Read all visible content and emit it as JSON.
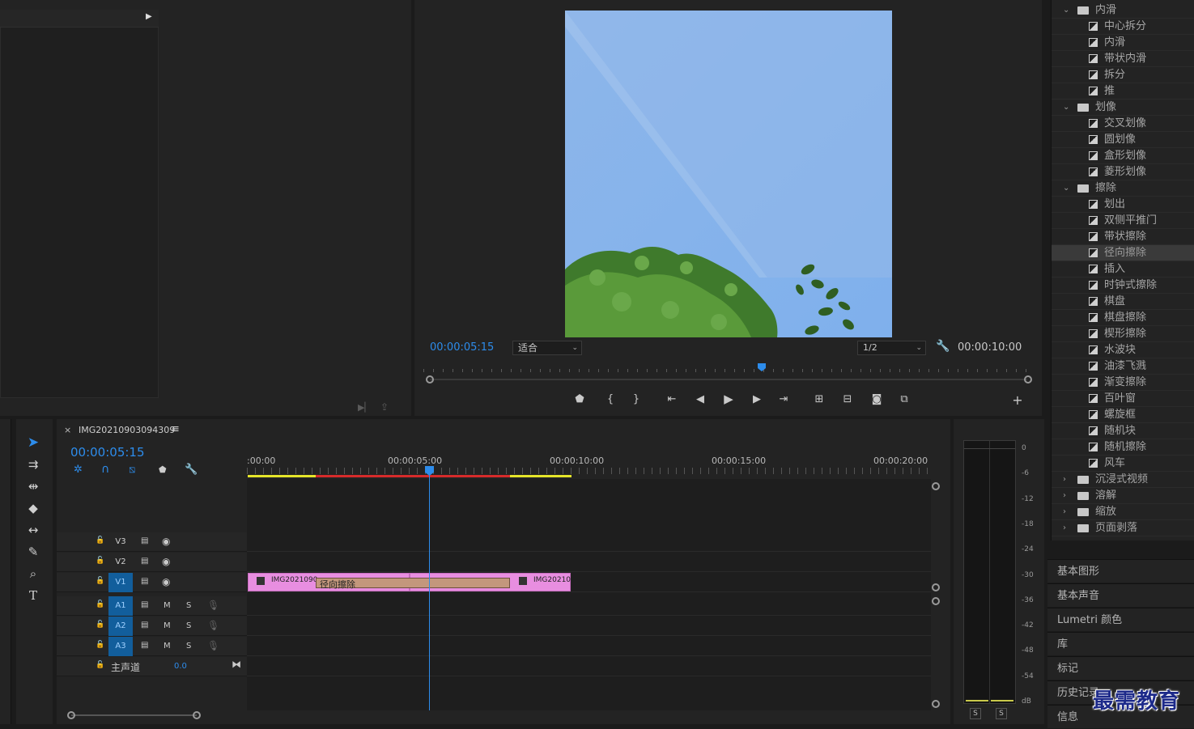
{
  "program": {
    "current_time": "00:00:05:15",
    "fit_label": "适合",
    "resolution": "1/2",
    "duration": "00:00:10:00"
  },
  "effects": {
    "items": [
      {
        "type": "folder",
        "label": "内滑",
        "expanded": true
      },
      {
        "type": "effect",
        "label": "中心拆分"
      },
      {
        "type": "effect",
        "label": "内滑"
      },
      {
        "type": "effect",
        "label": "带状内滑"
      },
      {
        "type": "effect",
        "label": "拆分"
      },
      {
        "type": "effect",
        "label": "推"
      },
      {
        "type": "folder",
        "label": "划像",
        "expanded": true
      },
      {
        "type": "effect",
        "label": "交叉划像"
      },
      {
        "type": "effect",
        "label": "圆划像"
      },
      {
        "type": "effect",
        "label": "盒形划像"
      },
      {
        "type": "effect",
        "label": "菱形划像"
      },
      {
        "type": "folder",
        "label": "擦除",
        "expanded": true
      },
      {
        "type": "effect",
        "label": "划出"
      },
      {
        "type": "effect",
        "label": "双侧平推门"
      },
      {
        "type": "effect",
        "label": "带状擦除"
      },
      {
        "type": "effect",
        "label": "径向擦除",
        "selected": true
      },
      {
        "type": "effect",
        "label": "插入"
      },
      {
        "type": "effect",
        "label": "时钟式擦除"
      },
      {
        "type": "effect",
        "label": "棋盘"
      },
      {
        "type": "effect",
        "label": "棋盘擦除"
      },
      {
        "type": "effect",
        "label": "楔形擦除"
      },
      {
        "type": "effect",
        "label": "水波块"
      },
      {
        "type": "effect",
        "label": "油漆飞溅"
      },
      {
        "type": "effect",
        "label": "渐变擦除"
      },
      {
        "type": "effect",
        "label": "百叶窗"
      },
      {
        "type": "effect",
        "label": "螺旋框"
      },
      {
        "type": "effect",
        "label": "随机块"
      },
      {
        "type": "effect",
        "label": "随机擦除"
      },
      {
        "type": "effect",
        "label": "风车"
      },
      {
        "type": "folder",
        "label": "沉浸式视频",
        "expanded": false
      },
      {
        "type": "folder",
        "label": "溶解",
        "expanded": false
      },
      {
        "type": "folder",
        "label": "缩放",
        "expanded": false
      },
      {
        "type": "folder",
        "label": "页面剥落",
        "expanded": false
      }
    ]
  },
  "side_panels": [
    "基本图形",
    "基本声音",
    "Lumetri 颜色",
    "库",
    "标记",
    "历史记录",
    "信息"
  ],
  "timeline": {
    "sequence_name": "IMG20210903094309",
    "current_time": "00:00:05:15",
    "ruler": [
      ":00:00",
      "00:00:05:00",
      "00:00:10:00",
      "00:00:15:00",
      "00:00:20:00"
    ],
    "video_tracks": [
      "V3",
      "V2",
      "V1"
    ],
    "audio_tracks": [
      "A1",
      "A2",
      "A3"
    ],
    "audio_buttons": {
      "mute": "M",
      "solo": "S"
    },
    "master_label": "主声道",
    "master_value": "0.0",
    "clip1_label": "IMG2021090",
    "clip2_label": "IMG20210",
    "transition_label": "径向擦除"
  },
  "meter": {
    "db_labels": [
      "0",
      "-6",
      "-12",
      "-18",
      "-24",
      "-30",
      "-36",
      "-42",
      "-48",
      "-54",
      "dB"
    ],
    "solo_labels": [
      "S",
      "S"
    ]
  },
  "watermark": "最需教育",
  "colors": {
    "accent_blue": "#2d8ceb",
    "clip_pink": "#e88ee0",
    "transition_tan": "#c3977c"
  }
}
